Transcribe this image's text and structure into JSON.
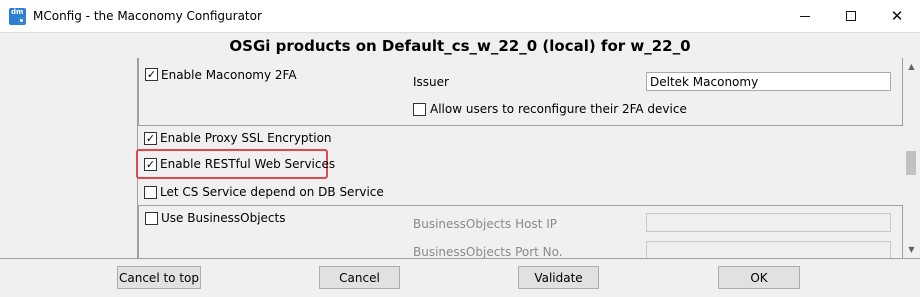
{
  "window": {
    "title": "MConfig  - the Maconomy Configurator",
    "icon": "mconfig-app-icon",
    "minimize_glyph": "—",
    "maximize_glyph": "☐",
    "close_glyph": "✕"
  },
  "header": {
    "title": "OSGi products on Default_cs_w_22_0 (local) for w_22_0"
  },
  "settings": {
    "twofa": {
      "label": "Enable Maconomy 2FA",
      "checked": true,
      "issuer_label": "Issuer",
      "issuer_value": "Deltek Maconomy",
      "allow_reconfigure_label": "Allow users to reconfigure their 2FA device",
      "allow_reconfigure_checked": false
    },
    "proxy_ssl": {
      "label": "Enable Proxy SSL Encryption",
      "checked": true
    },
    "restful": {
      "label": "Enable RESTful Web Services",
      "checked": true,
      "highlighted": true
    },
    "cs_depends_db": {
      "label": "Let CS Service depend on DB Service",
      "checked": false
    },
    "business_objects": {
      "label": "Use BusinessObjects",
      "checked": false,
      "host_label": "BusinessObjects Host IP",
      "host_value": "",
      "port_label": "BusinessObjects Port No.",
      "port_value": ""
    }
  },
  "check_glyph": "✓",
  "scrollbar": {
    "up_glyph": "▲",
    "down_glyph": "▼"
  },
  "footer": {
    "cancel_to_top": "Cancel to top",
    "cancel": "Cancel",
    "validate": "Validate",
    "ok": "OK"
  },
  "colors": {
    "highlight": "#e04a4a",
    "icon_blue": "#2d7fd3"
  }
}
